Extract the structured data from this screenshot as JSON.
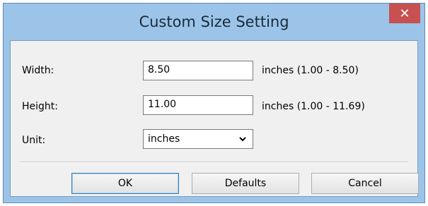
{
  "dialog": {
    "title": "Custom Size Setting",
    "close_glyph": "✕"
  },
  "fields": {
    "width": {
      "label": "Width:",
      "value": "8.50",
      "range": "inches (1.00 - 8.50)"
    },
    "height": {
      "label": "Height:",
      "value": "11.00",
      "range": "inches (1.00 - 11.69)"
    },
    "unit": {
      "label": "Unit:",
      "selected": "inches"
    }
  },
  "buttons": {
    "ok": "OK",
    "defaults": "Defaults",
    "cancel": "Cancel"
  },
  "colors": {
    "frame": "#9bc4e8",
    "close_button": "#c75050",
    "client_bg": "#f0f0f0"
  },
  "icons": {
    "close": "close-icon",
    "dropdown": "chevron-down-icon"
  }
}
